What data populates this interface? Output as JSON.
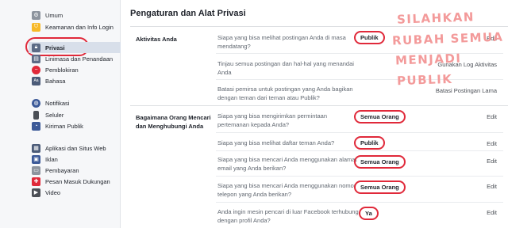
{
  "sidebar": {
    "items": [
      {
        "label": "Umum",
        "icon": "gear-icon"
      },
      {
        "label": "Keamanan dan Info Login",
        "icon": "shield-icon"
      },
      {
        "label": "Privasi",
        "icon": "lock-icon"
      },
      {
        "label": "Linimasa dan Penandaan",
        "icon": "timeline-icon"
      },
      {
        "label": "Pemblokiran",
        "icon": "block-icon"
      },
      {
        "label": "Bahasa",
        "icon": "language-icon"
      },
      {
        "label": "Notifikasi",
        "icon": "globe-icon"
      },
      {
        "label": "Seluler",
        "icon": "mobile-icon"
      },
      {
        "label": "Kiriman Publik",
        "icon": "rss-icon"
      },
      {
        "label": "Aplikasi dan Situs Web",
        "icon": "apps-icon"
      },
      {
        "label": "Iklan",
        "icon": "ads-icon"
      },
      {
        "label": "Pembayaran",
        "icon": "payment-icon"
      },
      {
        "label": "Pesan Masuk Dukungan",
        "icon": "support-icon"
      },
      {
        "label": "Video",
        "icon": "video-icon"
      }
    ]
  },
  "main": {
    "title": "Pengaturan dan Alat Privasi",
    "sections": [
      {
        "label": "Aktivitas Anda",
        "rows": [
          {
            "question": "Siapa yang bisa melihat postingan Anda di masa mendatang?",
            "value": "Publik",
            "edit": "Edit"
          },
          {
            "question": "Tinjau semua postingan dan hal-hal yang menandai Anda",
            "value": "",
            "edit": "Gunakan Log Aktivitas"
          },
          {
            "question": "Batasi pemirsa untuk postingan yang Anda bagikan dengan teman dari teman atau Publik?",
            "value": "",
            "edit": "Batasi Postingan Lama"
          }
        ]
      },
      {
        "label": "Bagaimana Orang Mencari dan Menghubungi Anda",
        "rows": [
          {
            "question": "Siapa yang bisa mengirimkan permintaan pertemanan kepada Anda?",
            "value": "Semua Orang",
            "edit": "Edit"
          },
          {
            "question": "Siapa yang bisa melihat daftar teman Anda?",
            "value": "Publik",
            "edit": "Edit"
          },
          {
            "question": "Siapa yang bisa mencari Anda menggunakan alamat email yang Anda berikan?",
            "value": "Semua Orang",
            "edit": "Edit"
          },
          {
            "question": "Siapa yang bisa mencari Anda menggunakan nomor telepon yang Anda berikan?",
            "value": "Semua Orang",
            "edit": "Edit"
          },
          {
            "question": "Anda ingin mesin pencari di luar Facebook terhubung dengan profil Anda?",
            "value": "Ya",
            "edit": "Edit"
          }
        ]
      }
    ]
  },
  "annotation": {
    "lines": [
      "SILAHKAN",
      "RUBAH SEMUA",
      "MENJADI",
      "PUBLIK"
    ],
    "color": "#f39a9a"
  },
  "colors": {
    "highlight_circle": "#e0293a",
    "sidebar_bg": "#f6f7f9",
    "active_bg": "#d8dfea"
  }
}
